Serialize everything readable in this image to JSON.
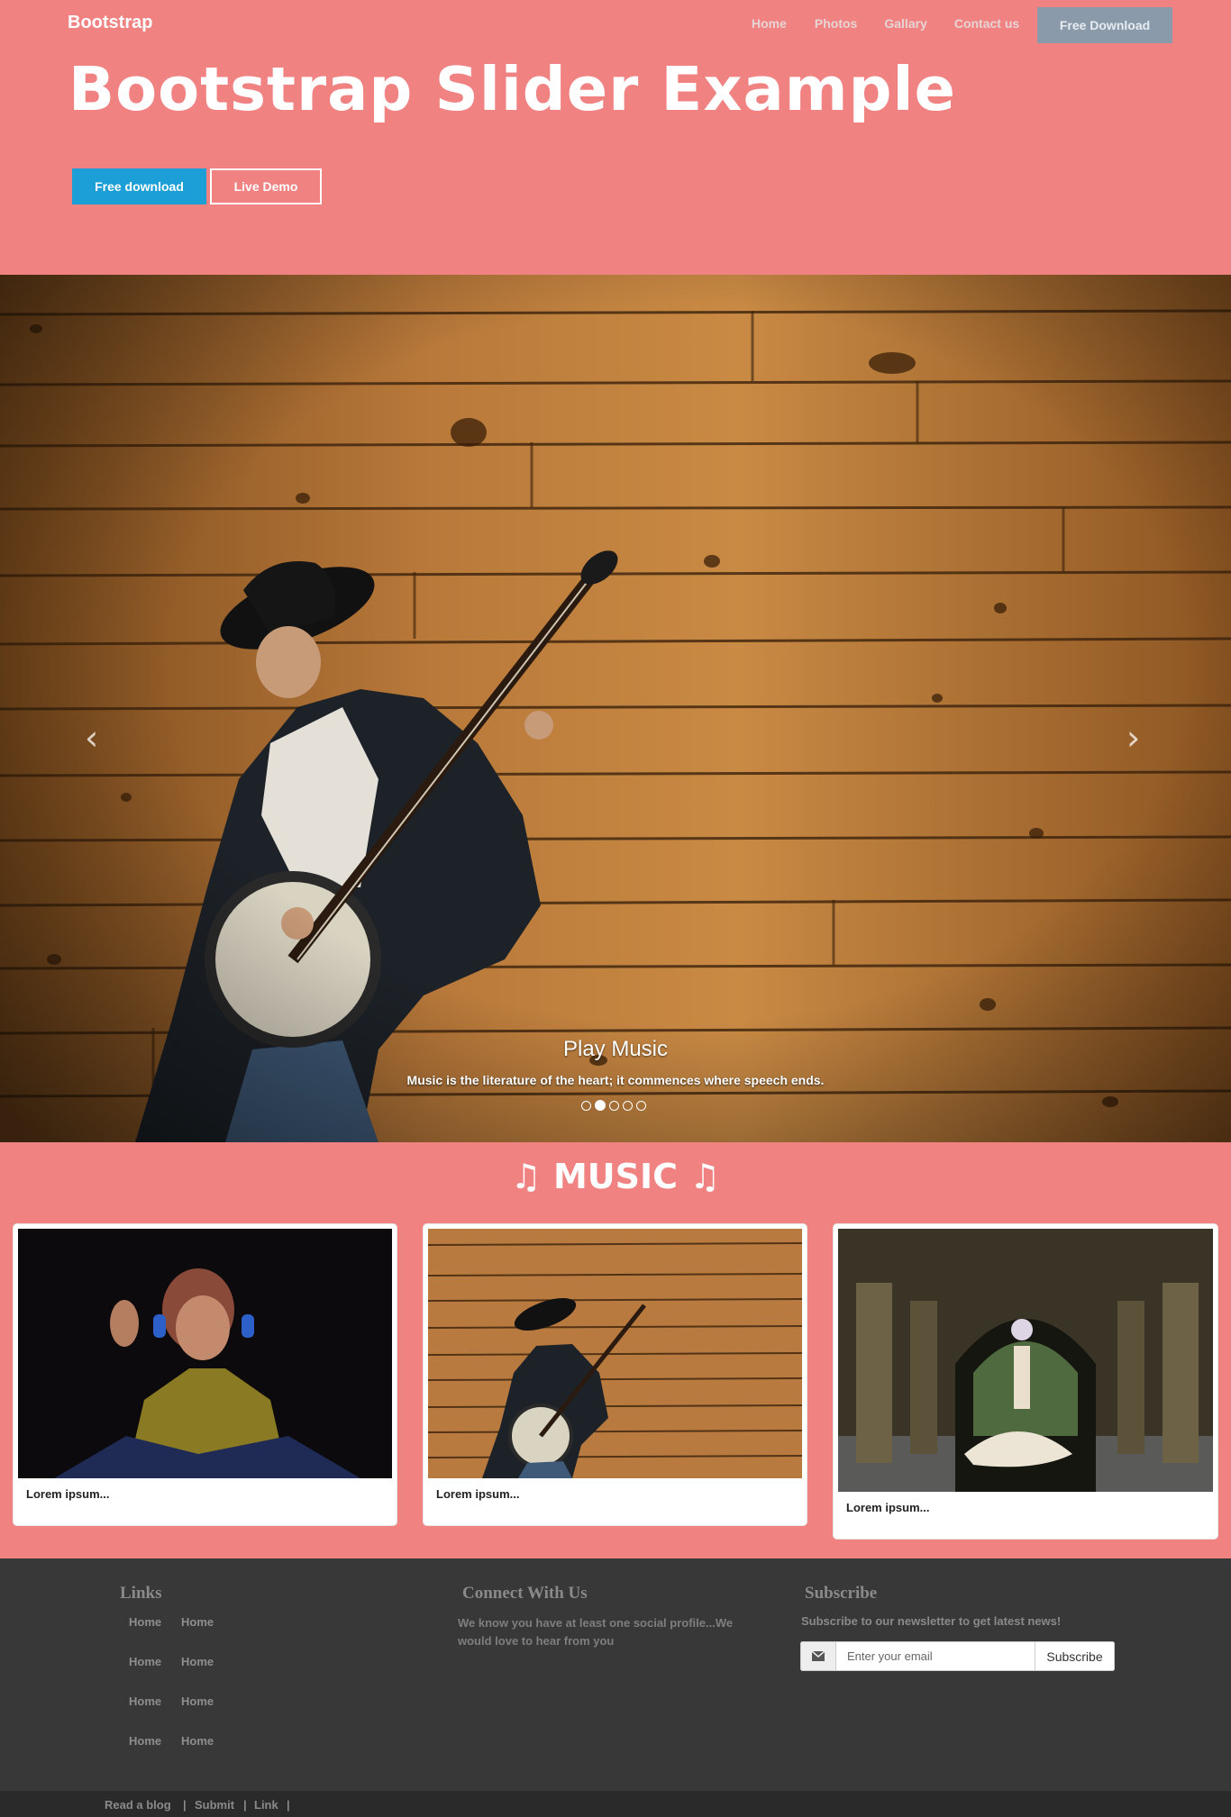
{
  "navbar": {
    "brand": "Bootstrap",
    "links": [
      "Home",
      "Photos",
      "Gallary",
      "Contact us"
    ],
    "cta": "Free Download"
  },
  "hero": {
    "title": "Bootstrap Slider Example",
    "primary_button": "Free download",
    "secondary_button": "Live Demo"
  },
  "slider": {
    "caption_title": "Play Music",
    "caption_text": "Music is the literature of the heart; it commences where speech ends.",
    "indicator_count": 5,
    "active_indicator": 2,
    "prev_icon": "chevron-left-icon",
    "next_icon": "chevron-right-icon"
  },
  "music": {
    "heading": "♫ MUSIC ♫",
    "cards": [
      {
        "caption": "Lorem ipsum..."
      },
      {
        "caption": "Lorem ipsum..."
      },
      {
        "caption": "Lorem ipsum..."
      }
    ]
  },
  "footer": {
    "links_heading": "Links",
    "links": [
      "Home",
      "Home",
      "Home",
      "Home",
      "Home",
      "Home",
      "Home",
      "Home"
    ],
    "connect_heading": "Connect With Us",
    "connect_text": "We know you have at least one social profile...We would love to hear from you",
    "subscribe_heading": "Subscribe",
    "subscribe_text": "Subscribe to our newsletter to get latest news!",
    "email_placeholder": "Enter your email",
    "subscribe_button": "Subscribe",
    "envelope_icon": "envelope-icon"
  },
  "bottom_bar": {
    "links": [
      "Read a blog",
      "Submit",
      "Link"
    ],
    "separator": "|"
  },
  "colors": {
    "page_background": "#f08282",
    "primary_button": "#1c9fd6",
    "nav_cta": "#8a9aaa",
    "footer": "#383838",
    "bottom_bar": "#2a2a2a"
  }
}
